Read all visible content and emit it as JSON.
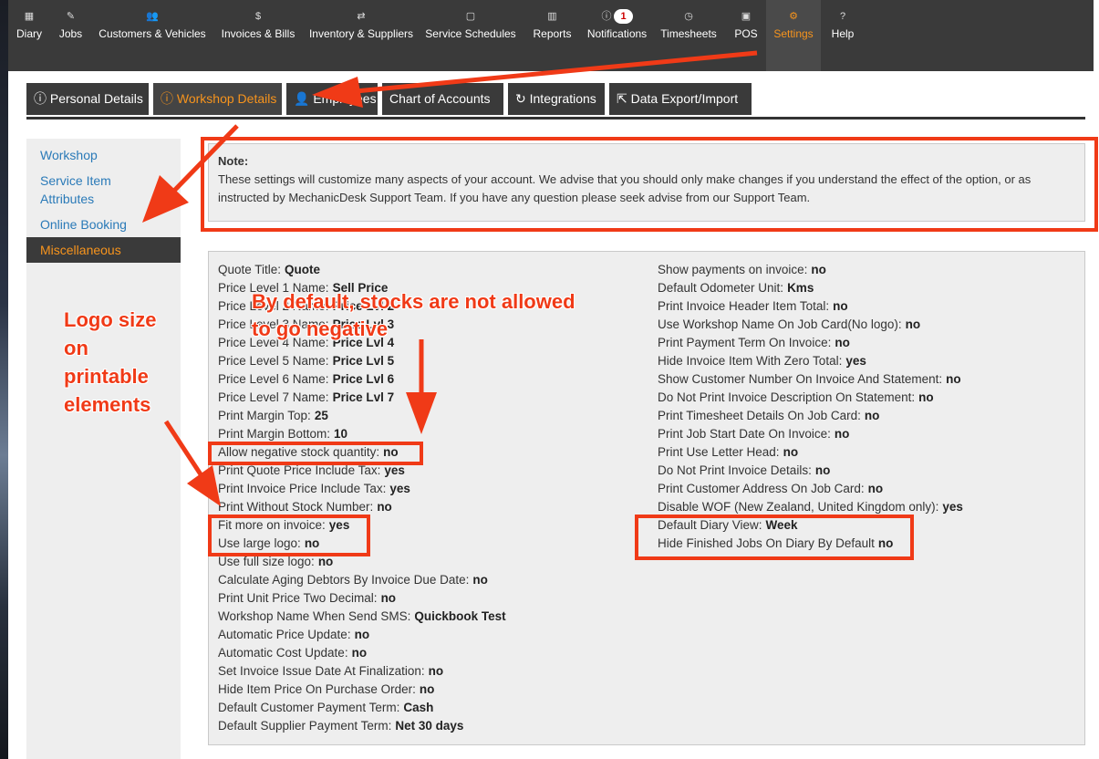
{
  "nav": [
    {
      "icon": "calendar-icon",
      "glyph": "▦",
      "label": "Diary"
    },
    {
      "icon": "wrench-icon",
      "glyph": "✎",
      "label": "Jobs"
    },
    {
      "icon": "users-icon",
      "glyph": "👥",
      "label": "Customers & Vehicles"
    },
    {
      "icon": "dollar-icon",
      "glyph": "$",
      "label": "Invoices & Bills"
    },
    {
      "icon": "retweet-icon",
      "glyph": "⇄",
      "label": "Inventory & Suppliers"
    },
    {
      "icon": "calendar-o-icon",
      "glyph": "▢",
      "label": "Service Schedules"
    },
    {
      "icon": "bar-chart-icon",
      "glyph": "▥",
      "label": "Reports"
    },
    {
      "icon": "info-icon",
      "glyph": "ⓘ",
      "label": "Notifications",
      "badge": "1"
    },
    {
      "icon": "clock-icon",
      "glyph": "◷",
      "label": "Timesheets"
    },
    {
      "icon": "pos-icon",
      "glyph": "▣",
      "label": "POS"
    },
    {
      "icon": "cogs-icon",
      "glyph": "⚙",
      "label": "Settings"
    },
    {
      "icon": "question-icon",
      "glyph": "?",
      "label": "Help"
    }
  ],
  "tabs": [
    {
      "icon": "info-icon",
      "glyph": "ⓘ",
      "label": "Personal Details"
    },
    {
      "icon": "info-icon",
      "glyph": "ⓘ",
      "label": "Workshop Details"
    },
    {
      "icon": "user-icon",
      "glyph": "👤",
      "label": "Employees"
    },
    {
      "icon": "",
      "glyph": "",
      "label": "Chart of Accounts"
    },
    {
      "icon": "refresh-icon",
      "glyph": "↻",
      "label": "Integrations"
    },
    {
      "icon": "external-link-icon",
      "glyph": "⇱",
      "label": "Data Export/Import"
    }
  ],
  "sidebar": [
    "Workshop",
    "Service Item Attributes",
    "Online Booking",
    "Miscellaneous"
  ],
  "note": {
    "title": "Note:",
    "text": "These settings will customize many aspects of your account. We advise that you should only make changes if you understand the effect of the option, or as instructed by MechanicDesk Support Team. If you have any question please seek advise from our Support Team."
  },
  "left_settings": [
    {
      "label": "Quote Title:",
      "value": "Quote"
    },
    {
      "label": "Price Level 1 Name:",
      "value": "Sell Price"
    },
    {
      "label": "Price Level 2 Name:",
      "value": "Price Lvl 2"
    },
    {
      "label": "Price Level 3 Name:",
      "value": "Price Lvl 3"
    },
    {
      "label": "Price Level 4 Name:",
      "value": "Price Lvl 4"
    },
    {
      "label": "Price Level 5 Name:",
      "value": "Price Lvl 5"
    },
    {
      "label": "Price Level 6 Name:",
      "value": "Price Lvl 6"
    },
    {
      "label": "Price Level 7 Name:",
      "value": "Price Lvl 7"
    },
    {
      "label": "Print Margin Top:",
      "value": "25"
    },
    {
      "label": "Print Margin Bottom:",
      "value": "10"
    },
    {
      "label": "Allow negative stock quantity:",
      "value": "no"
    },
    {
      "label": "Print Quote Price Include Tax:",
      "value": "yes"
    },
    {
      "label": "Print Invoice Price Include Tax:",
      "value": "yes"
    },
    {
      "label": "Print Without Stock Number:",
      "value": "no"
    },
    {
      "label": "Fit more on invoice:",
      "value": "yes"
    },
    {
      "label": "Use large logo:",
      "value": "no"
    },
    {
      "label": "Use full size logo:",
      "value": "no"
    },
    {
      "label": "Calculate Aging Debtors By Invoice Due Date:",
      "value": "no"
    },
    {
      "label": "Print Unit Price Two Decimal:",
      "value": "no"
    },
    {
      "label": "Workshop Name When Send SMS:",
      "value": "Quickbook Test"
    },
    {
      "label": "Automatic Price Update:",
      "value": "no"
    },
    {
      "label": "Automatic Cost Update:",
      "value": "no"
    },
    {
      "label": "Set Invoice Issue Date At Finalization:",
      "value": "no"
    },
    {
      "label": "Hide Item Price On Purchase Order:",
      "value": "no"
    },
    {
      "label": "Default Customer Payment Term:",
      "value": "Cash"
    },
    {
      "label": "Default Supplier Payment Term:",
      "value": "Net 30 days"
    }
  ],
  "right_settings": [
    {
      "label": "Show payments on invoice:",
      "value": "no"
    },
    {
      "label": "Default Odometer Unit:",
      "value": "Kms"
    },
    {
      "label": "Print Invoice Header Item Total:",
      "value": "no"
    },
    {
      "label": "Use Workshop Name On Job Card(No logo):",
      "value": "no"
    },
    {
      "label": "Print Payment Term On Invoice:",
      "value": "no"
    },
    {
      "label": "Hide Invoice Item With Zero Total:",
      "value": "yes"
    },
    {
      "label": "Show Customer Number On Invoice And Statement:",
      "value": "no"
    },
    {
      "label": "Do Not Print Invoice Description On Statement:",
      "value": "no"
    },
    {
      "label": "Print Timesheet Details On Job Card:",
      "value": "no"
    },
    {
      "label": "Print Job Start Date On Invoice:",
      "value": "no"
    },
    {
      "label": "Print Use Letter Head:",
      "value": "no"
    },
    {
      "label": "Do Not Print Invoice Details:",
      "value": "no"
    },
    {
      "label": "Print Customer Address On Job Card:",
      "value": "no"
    },
    {
      "label": "Disable WOF (New Zealand, United Kingdom only):",
      "value": "yes"
    },
    {
      "label": "Default Diary View:",
      "value": "Week"
    },
    {
      "label": "Hide Finished Jobs On Diary By Default",
      "value": "no"
    }
  ],
  "annotations": {
    "stocks_line1": "By default, stocks are not allowed",
    "stocks_line2": "to go negative",
    "logo_line1": "Logo size",
    "logo_line2": "on",
    "logo_line3": "printable",
    "logo_line4": "elements"
  },
  "colors": {
    "accent": "#f7941d",
    "annotation": "#f03a17",
    "nav_bg": "#3a3a3a",
    "link": "#2a7ab8"
  }
}
